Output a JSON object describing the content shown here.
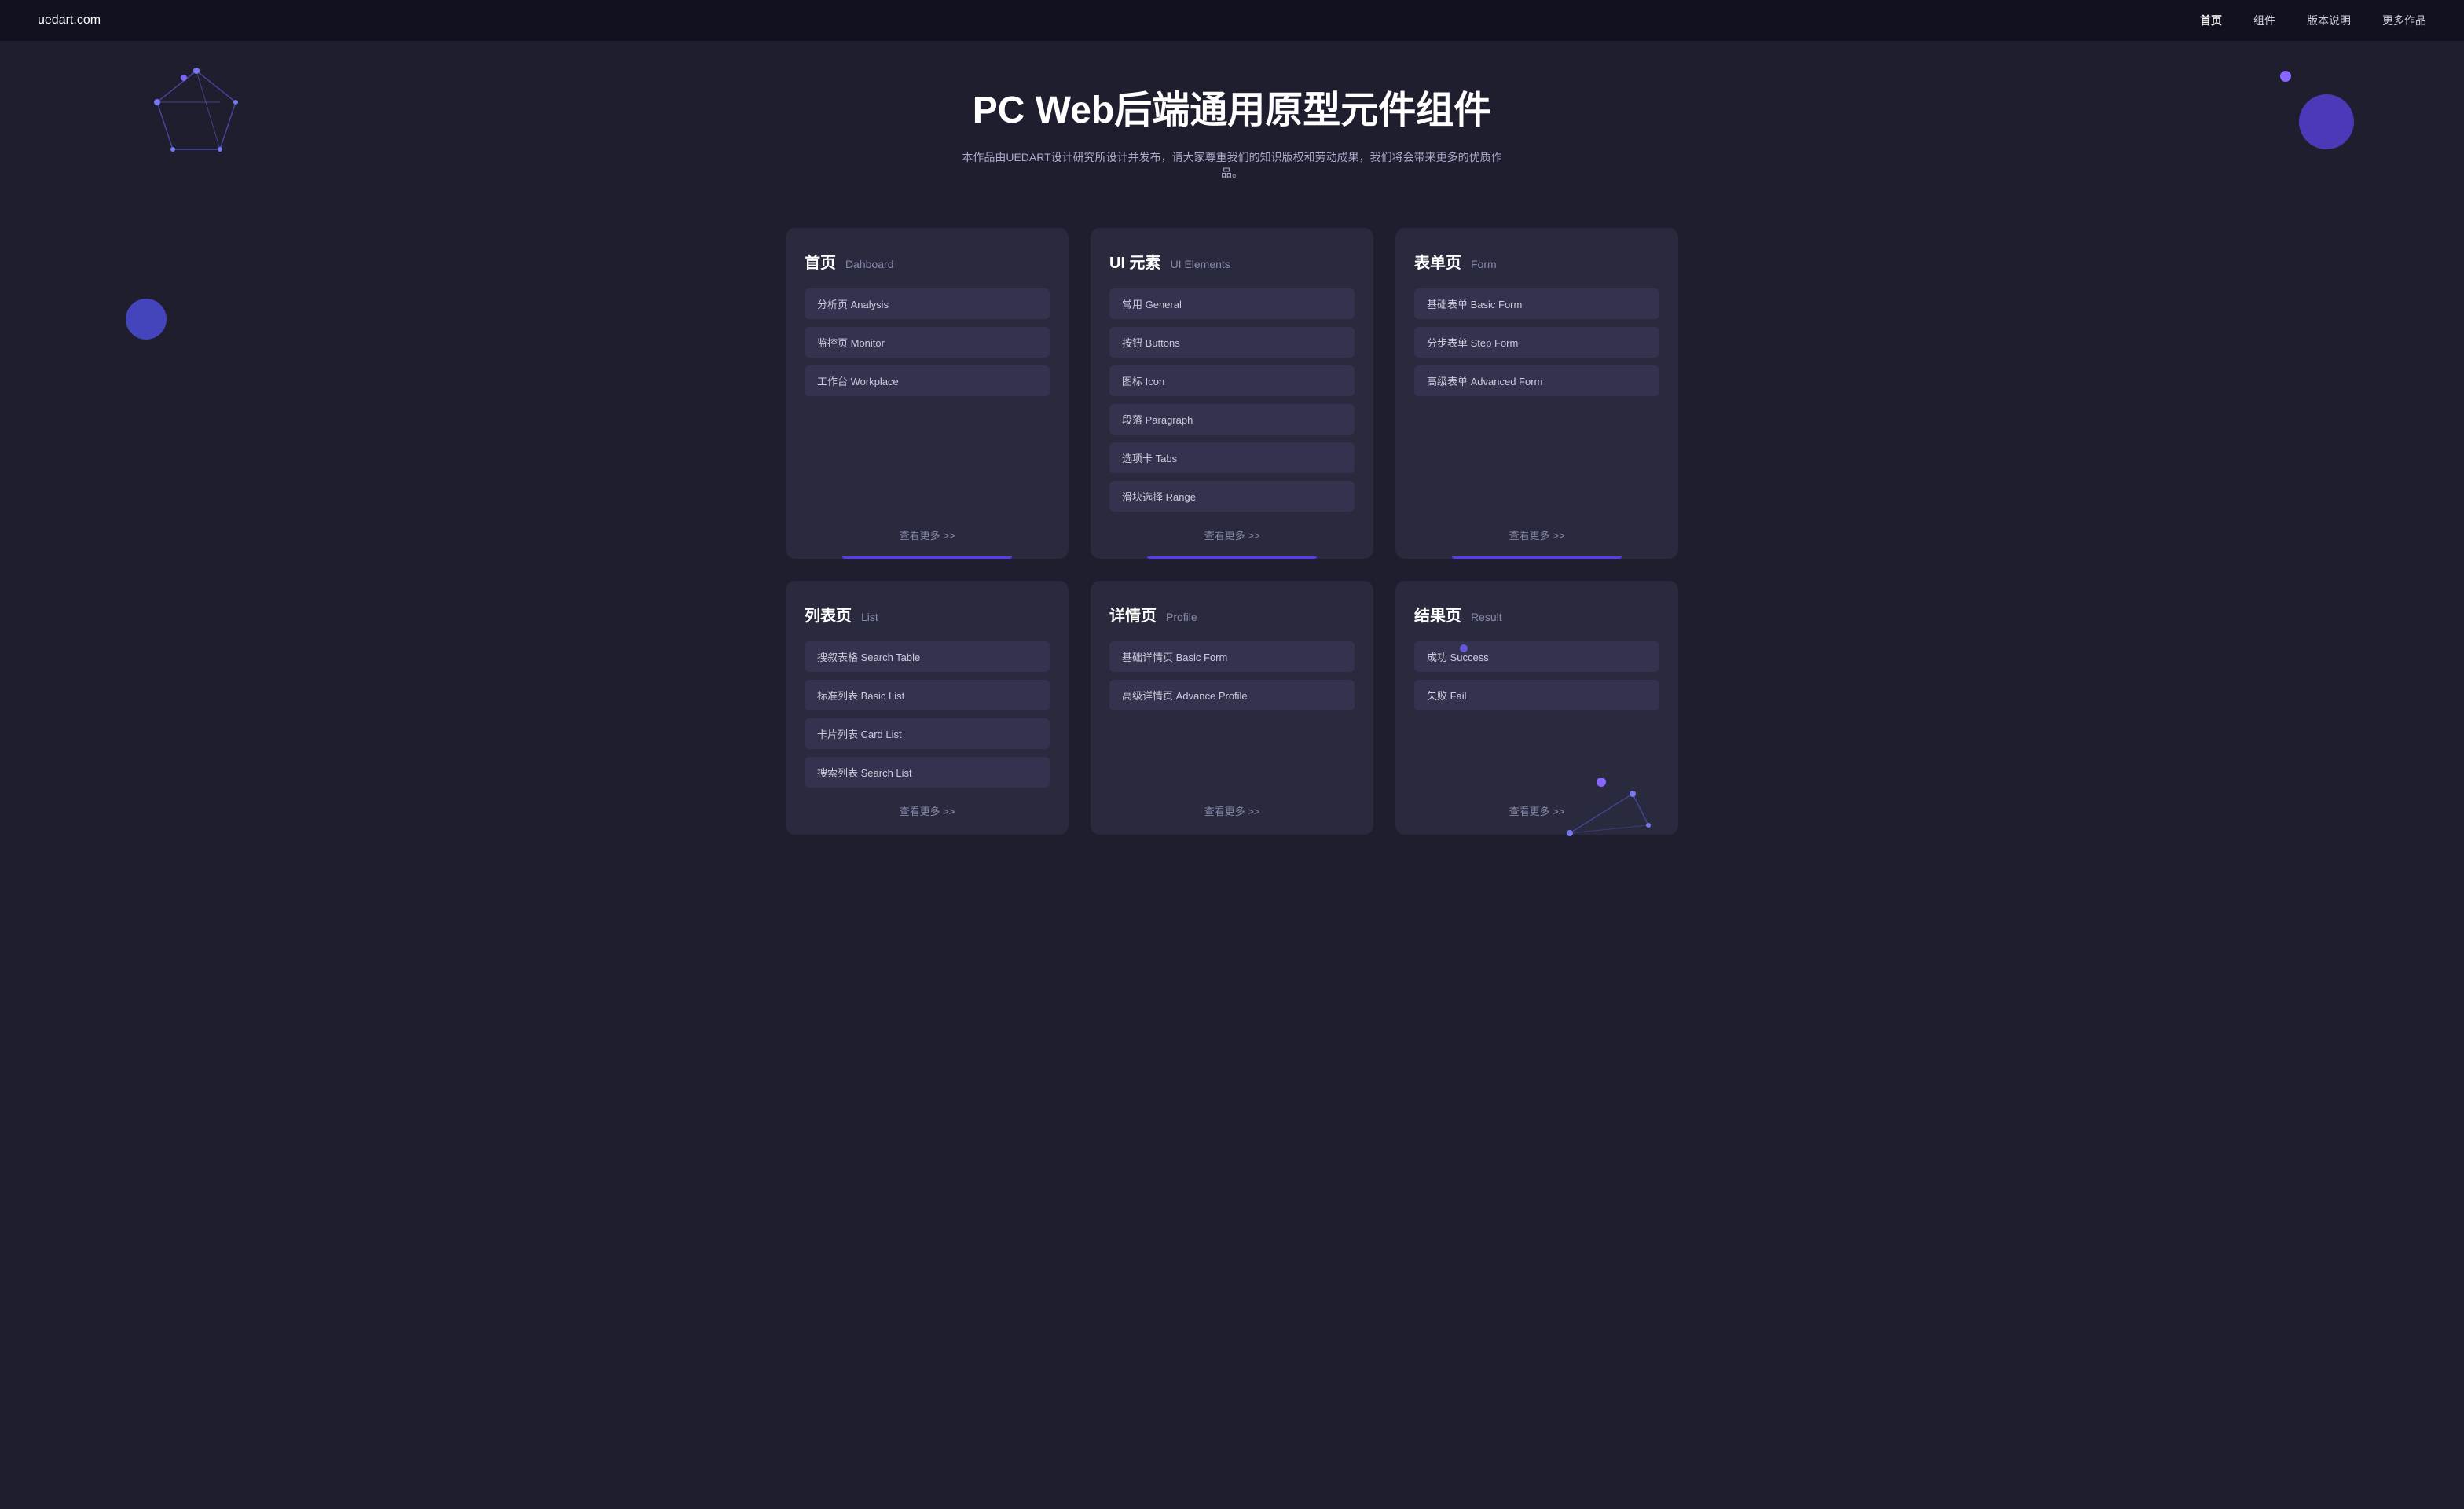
{
  "nav": {
    "logo": "uedart.com",
    "links": [
      {
        "label": "首页",
        "active": true
      },
      {
        "label": "组件",
        "active": false
      },
      {
        "label": "版本说明",
        "active": false
      },
      {
        "label": "更多作品",
        "active": false
      }
    ]
  },
  "hero": {
    "title": "PC Web后端通用原型元件组件",
    "subtitle": "本作品由UEDART设计研究所设计并发布，请大家尊重我们的知识版权和劳动成果，我们将会带来更多的优质作品。"
  },
  "cards_row1": [
    {
      "id": "dashboard",
      "title_cn": "首页",
      "title_en": "Dahboard",
      "items": [
        {
          "label": "分析页 Analysis"
        },
        {
          "label": "监控页 Monitor"
        },
        {
          "label": "工作台 Workplace"
        }
      ],
      "more": "查看更多 >>"
    },
    {
      "id": "ui-elements",
      "title_cn": "UI 元素",
      "title_en": "UI Elements",
      "items": [
        {
          "label": "常用 General"
        },
        {
          "label": "按钮 Buttons"
        },
        {
          "label": "图标 Icon"
        },
        {
          "label": "段落 Paragraph"
        },
        {
          "label": "选项卡 Tabs"
        },
        {
          "label": "滑块选择 Range"
        }
      ],
      "more": "查看更多 >>"
    },
    {
      "id": "form",
      "title_cn": "表单页",
      "title_en": "Form",
      "items": [
        {
          "label": "基础表单 Basic Form"
        },
        {
          "label": "分步表单 Step Form"
        },
        {
          "label": "高级表单 Advanced Form"
        }
      ],
      "more": "查看更多 >>"
    }
  ],
  "cards_row2": [
    {
      "id": "list",
      "title_cn": "列表页",
      "title_en": "List",
      "items": [
        {
          "label": "搜叙表格 Search Table"
        },
        {
          "label": "标准列表 Basic List"
        },
        {
          "label": "卡片列表 Card List"
        },
        {
          "label": "搜索列表 Search List"
        }
      ],
      "more": "查看更多 >>"
    },
    {
      "id": "profile",
      "title_cn": "详情页",
      "title_en": "Profile",
      "items": [
        {
          "label": "基础详情页 Basic Form"
        },
        {
          "label": "高级详情页 Advance Profile"
        }
      ],
      "more": "查看更多 >>"
    },
    {
      "id": "result",
      "title_cn": "结果页",
      "title_en": "Result",
      "items": [
        {
          "label": "成功 Success"
        },
        {
          "label": "失败 Fail"
        }
      ],
      "more": "查看更多 >>"
    }
  ]
}
